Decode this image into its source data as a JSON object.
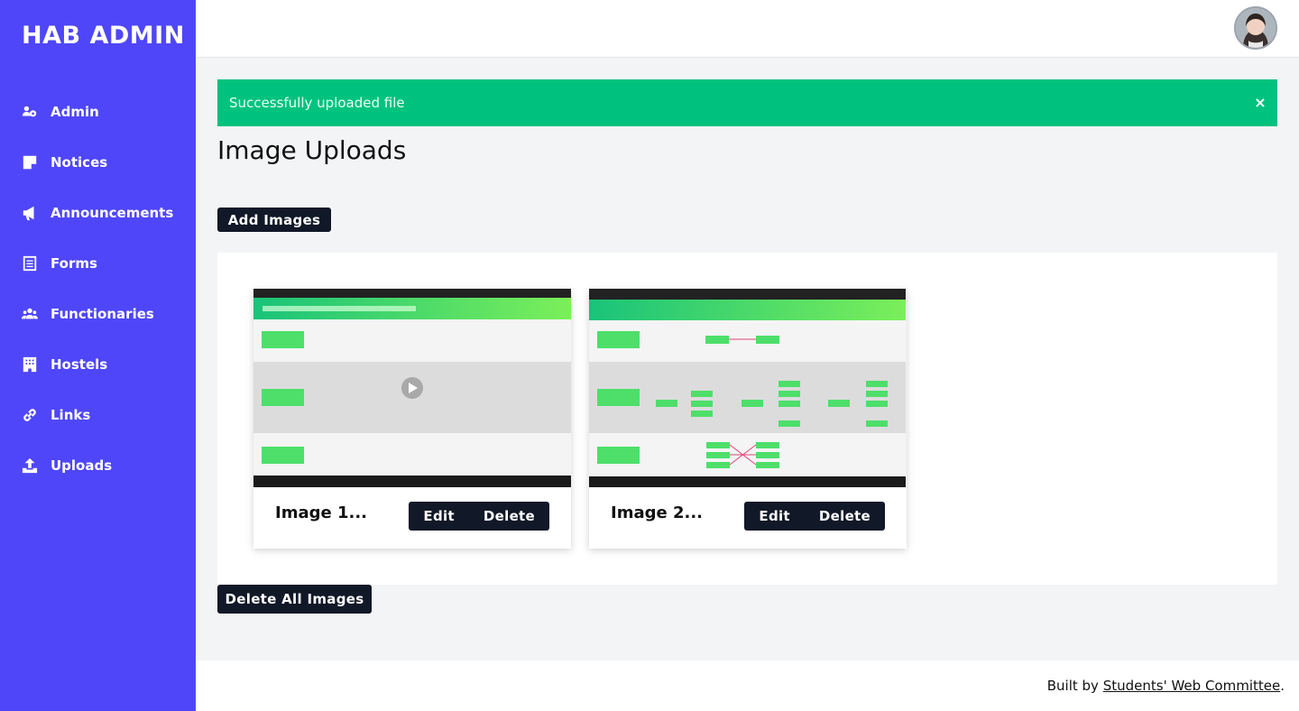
{
  "sidebar": {
    "brand": "HAB ADMIN",
    "items": [
      {
        "label": "Admin",
        "icon": "users-cog-icon"
      },
      {
        "label": "Notices",
        "icon": "sticky-note-icon"
      },
      {
        "label": "Announcements",
        "icon": "bullhorn-icon"
      },
      {
        "label": "Forms",
        "icon": "form-icon"
      },
      {
        "label": "Functionaries",
        "icon": "users-icon"
      },
      {
        "label": "Hostels",
        "icon": "building-icon"
      },
      {
        "label": "Links",
        "icon": "link-icon"
      },
      {
        "label": "Uploads",
        "icon": "upload-icon"
      }
    ]
  },
  "colors": {
    "sidebar": "#4f46fa",
    "alert": "#00c27f",
    "button": "#111827",
    "background": "#f3f4f6"
  },
  "alert": {
    "message": "Successfully uploaded file",
    "close": "×"
  },
  "page": {
    "title": "Image Uploads",
    "add_button": "Add Images",
    "delete_all_button": "Delete All Images"
  },
  "images": [
    {
      "title": "Image 1...",
      "edit": "Edit",
      "delete": "Delete"
    },
    {
      "title": "Image 2...",
      "edit": "Edit",
      "delete": "Delete"
    }
  ],
  "footer": {
    "prefix": "Built by ",
    "link": "Students' Web Committee",
    "suffix": "."
  }
}
